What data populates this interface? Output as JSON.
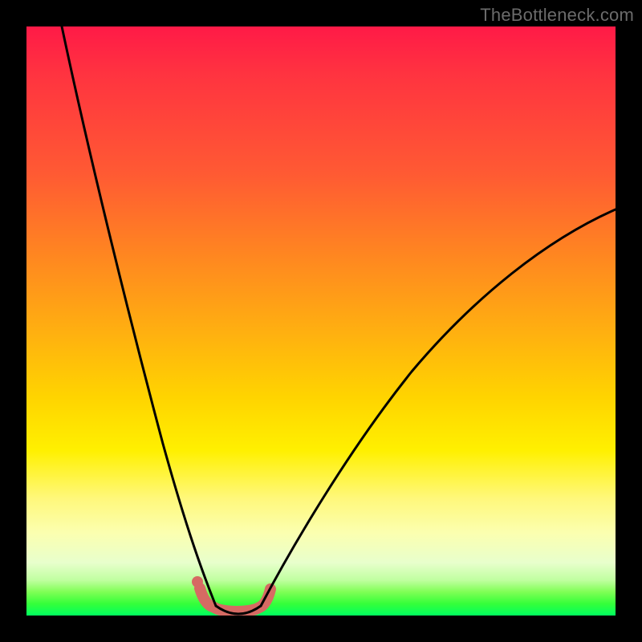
{
  "watermark": "TheBottleneck.com",
  "chart_data": {
    "type": "line",
    "title": "",
    "xlabel": "",
    "ylabel": "",
    "xlim": [
      0,
      100
    ],
    "ylim": [
      0,
      100
    ],
    "background_gradient_meaning": "top=100 (red/bad), bottom=0 (green/good)",
    "series": [
      {
        "name": "left-descending-curve",
        "x": [
          6,
          9,
          12,
          15,
          18,
          21,
          24,
          27,
          29,
          31,
          32.5
        ],
        "y": [
          100,
          82,
          66,
          52,
          40,
          30,
          21,
          13,
          7,
          3,
          1
        ]
      },
      {
        "name": "valley-floor",
        "x": [
          32.5,
          34,
          36,
          38,
          40
        ],
        "y": [
          1,
          0,
          0,
          0,
          1
        ]
      },
      {
        "name": "right-ascending-curve",
        "x": [
          40,
          44,
          50,
          56,
          64,
          72,
          80,
          88,
          96,
          100
        ],
        "y": [
          1,
          6,
          14,
          23,
          34,
          44,
          53,
          60,
          66,
          69
        ]
      }
    ],
    "highlight": {
      "name": "valley-highlight",
      "x": [
        29.5,
        31,
        33,
        35,
        37,
        39,
        40.5
      ],
      "y": [
        4.5,
        1.5,
        0.5,
        0.5,
        0.5,
        1.5,
        4.5
      ],
      "color": "#d66a63",
      "stroke_width_px": 14
    }
  }
}
